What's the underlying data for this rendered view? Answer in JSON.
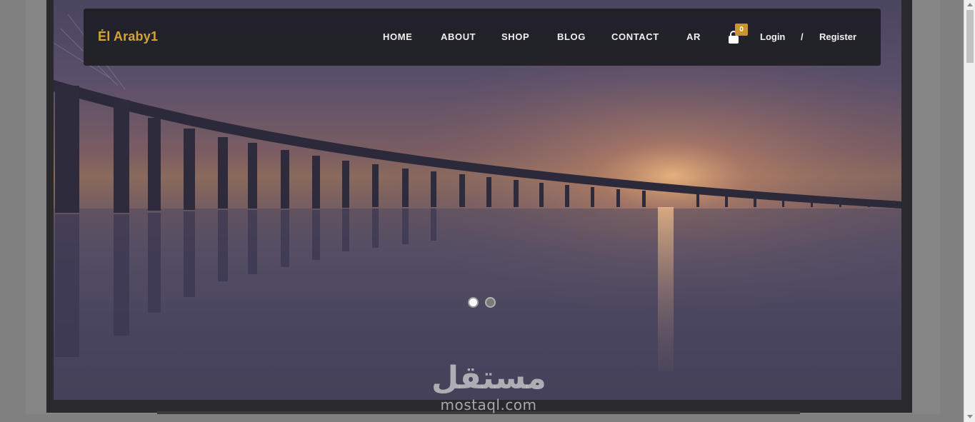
{
  "brand": {
    "name": "Ėl Araby1"
  },
  "nav": {
    "items": [
      {
        "label": "HOME"
      },
      {
        "label": "ABOUT"
      },
      {
        "label": "SHOP"
      },
      {
        "label": "BLOG"
      },
      {
        "label": "CONTACT"
      },
      {
        "label": "AR"
      }
    ]
  },
  "cart": {
    "icon": "shopping-bag-icon",
    "count": "0"
  },
  "auth": {
    "login": "Login",
    "separator": "/",
    "register": "Register"
  },
  "slider": {
    "slides": 2,
    "active": 1
  },
  "watermark": {
    "arabic": "مستقل",
    "latin": "mostaql.com"
  },
  "colors": {
    "brand": "#d4a33a",
    "badge": "#c9952e",
    "navbar": "#1e1e24"
  }
}
